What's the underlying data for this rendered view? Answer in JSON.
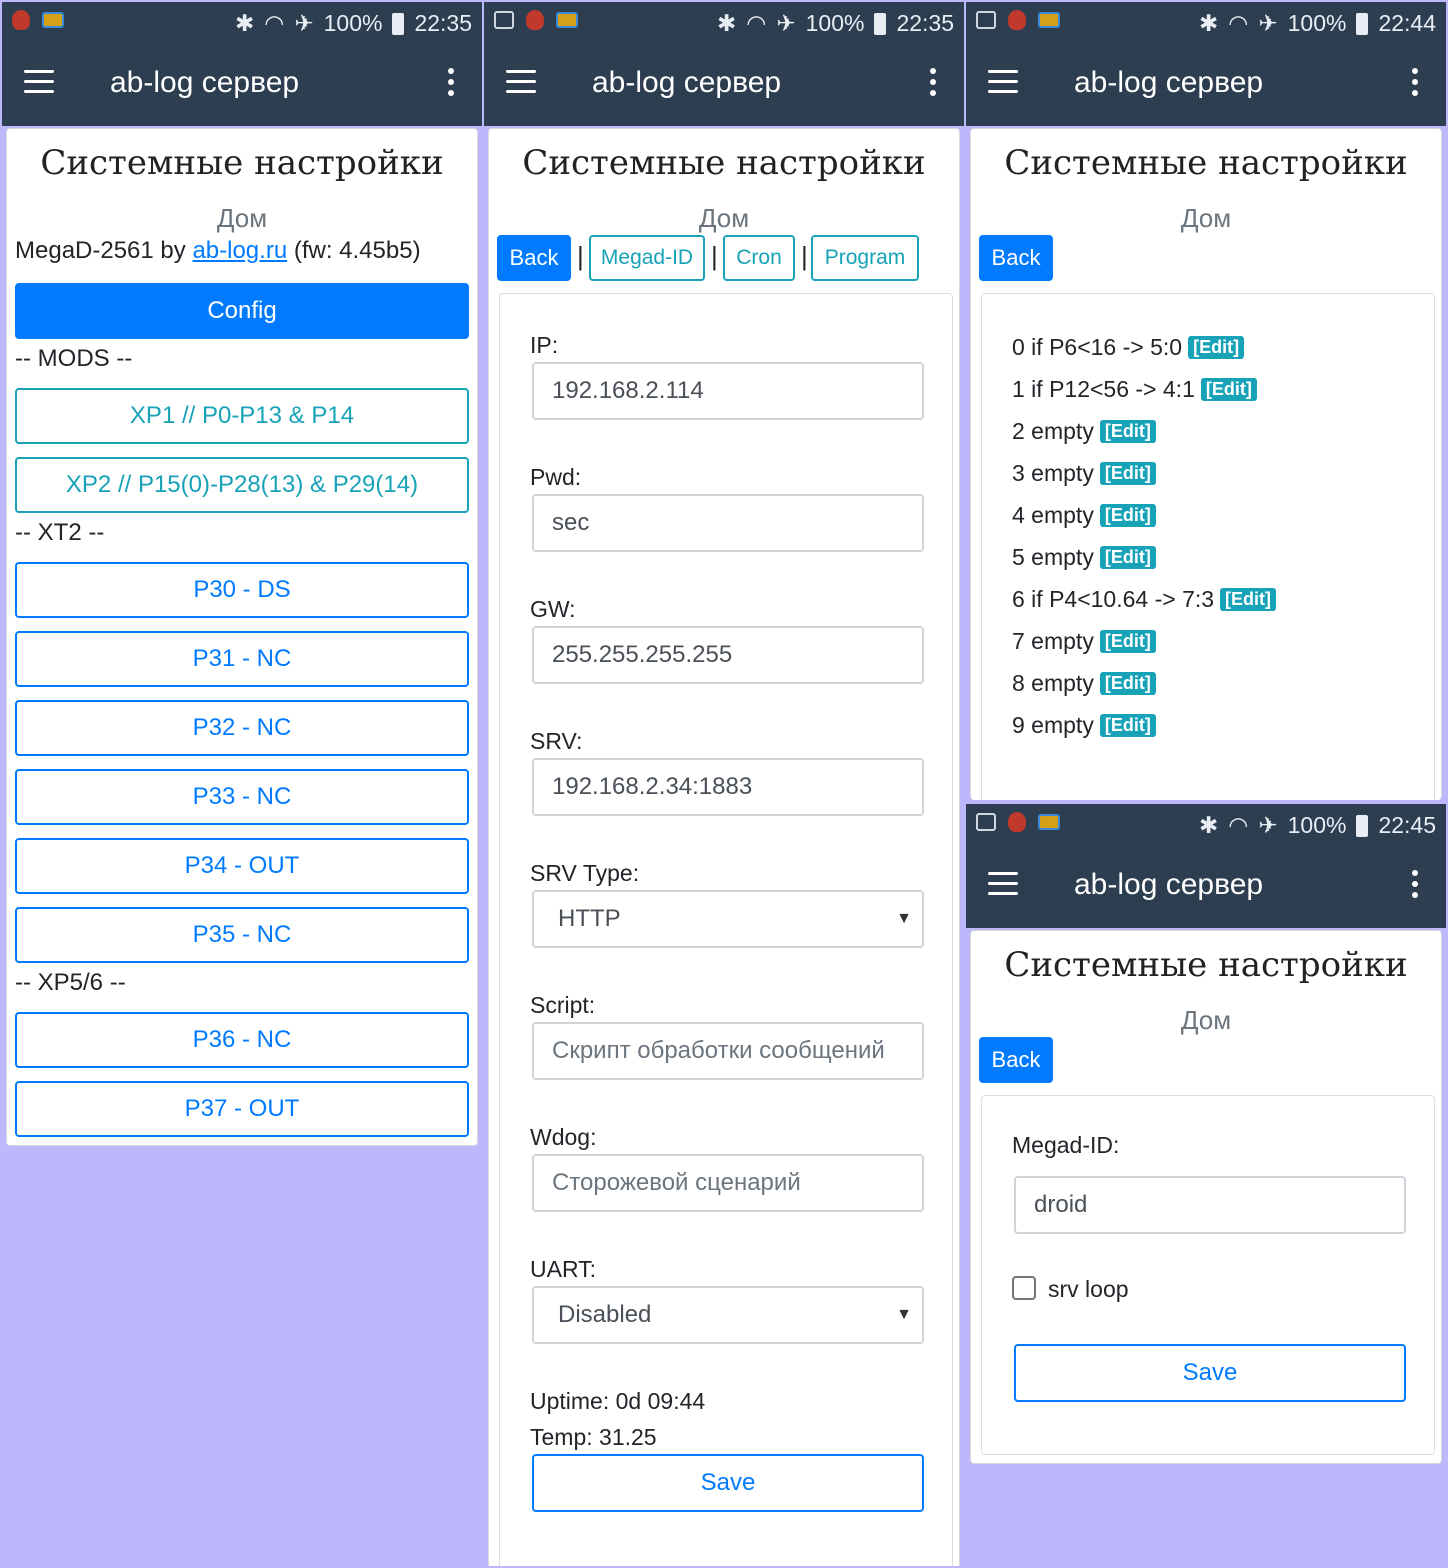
{
  "common": {
    "app_title": "ab-log сервер",
    "page_title": "Системные настройки",
    "subtitle": "Дом",
    "battery": "100%"
  },
  "panel1": {
    "time": "22:35",
    "device_prefix": "MegaD-2561 by ",
    "device_link": "ab-log.ru",
    "device_suffix": " (fw: 4.45b5)",
    "config_label": "Config",
    "mods_header": "-- MODS --",
    "xp1_label": "XP1 // P0-P13 & P14",
    "xp2_label": "XP2 // P15(0)-P28(13) & P29(14)",
    "xt2_header": "-- XT2 --",
    "xt2_ports": [
      "P30 - DS",
      "P31 - NC",
      "P32 - NC",
      "P33 - NC",
      "P34 - OUT",
      "P35 - NC"
    ],
    "xp56_header": "-- XP5/6 --",
    "xp56_ports": [
      "P36 - NC",
      "P37 - OUT"
    ]
  },
  "panel2": {
    "time": "22:35",
    "tabs": {
      "back": "Back",
      "megad_id": "Megad-ID",
      "cron": "Cron",
      "program": "Program",
      "separator": "|"
    },
    "fields": {
      "ip_label": "IP:",
      "ip_value": "192.168.2.114",
      "pwd_label": "Pwd:",
      "pwd_value": "sec",
      "gw_label": "GW:",
      "gw_value": "255.255.255.255",
      "srv_label": "SRV:",
      "srv_value": "192.168.2.34:1883",
      "srv_type_label": "SRV Type:",
      "srv_type_value": "HTTP",
      "script_label": "Script:",
      "script_placeholder": "Скрипт обработки сообщений",
      "wdog_label": "Wdog:",
      "wdog_placeholder": "Сторожевой сценарий",
      "uart_label": "UART:",
      "uart_value": "Disabled"
    },
    "uptime": "Uptime: 0d 09:44",
    "temp": "Temp: 31.25",
    "save_label": "Save"
  },
  "panel3": {
    "time": "22:44",
    "back_label": "Back",
    "edit_label": "[Edit]",
    "cron_lines": [
      "0 if P6<16 -> 5:0",
      "1 if P12<56 -> 4:1",
      "2 empty",
      "3 empty",
      "4 empty",
      "5 empty",
      "6 if P4<10.64 -> 7:3",
      "7 empty",
      "8 empty",
      "9 empty"
    ]
  },
  "panel4": {
    "time": "22:45",
    "back_label": "Back",
    "megad_id_label": "Megad-ID:",
    "megad_id_value": "droid",
    "srv_loop_label": "srv loop",
    "srv_loop_checked": false,
    "save_label": "Save"
  }
}
